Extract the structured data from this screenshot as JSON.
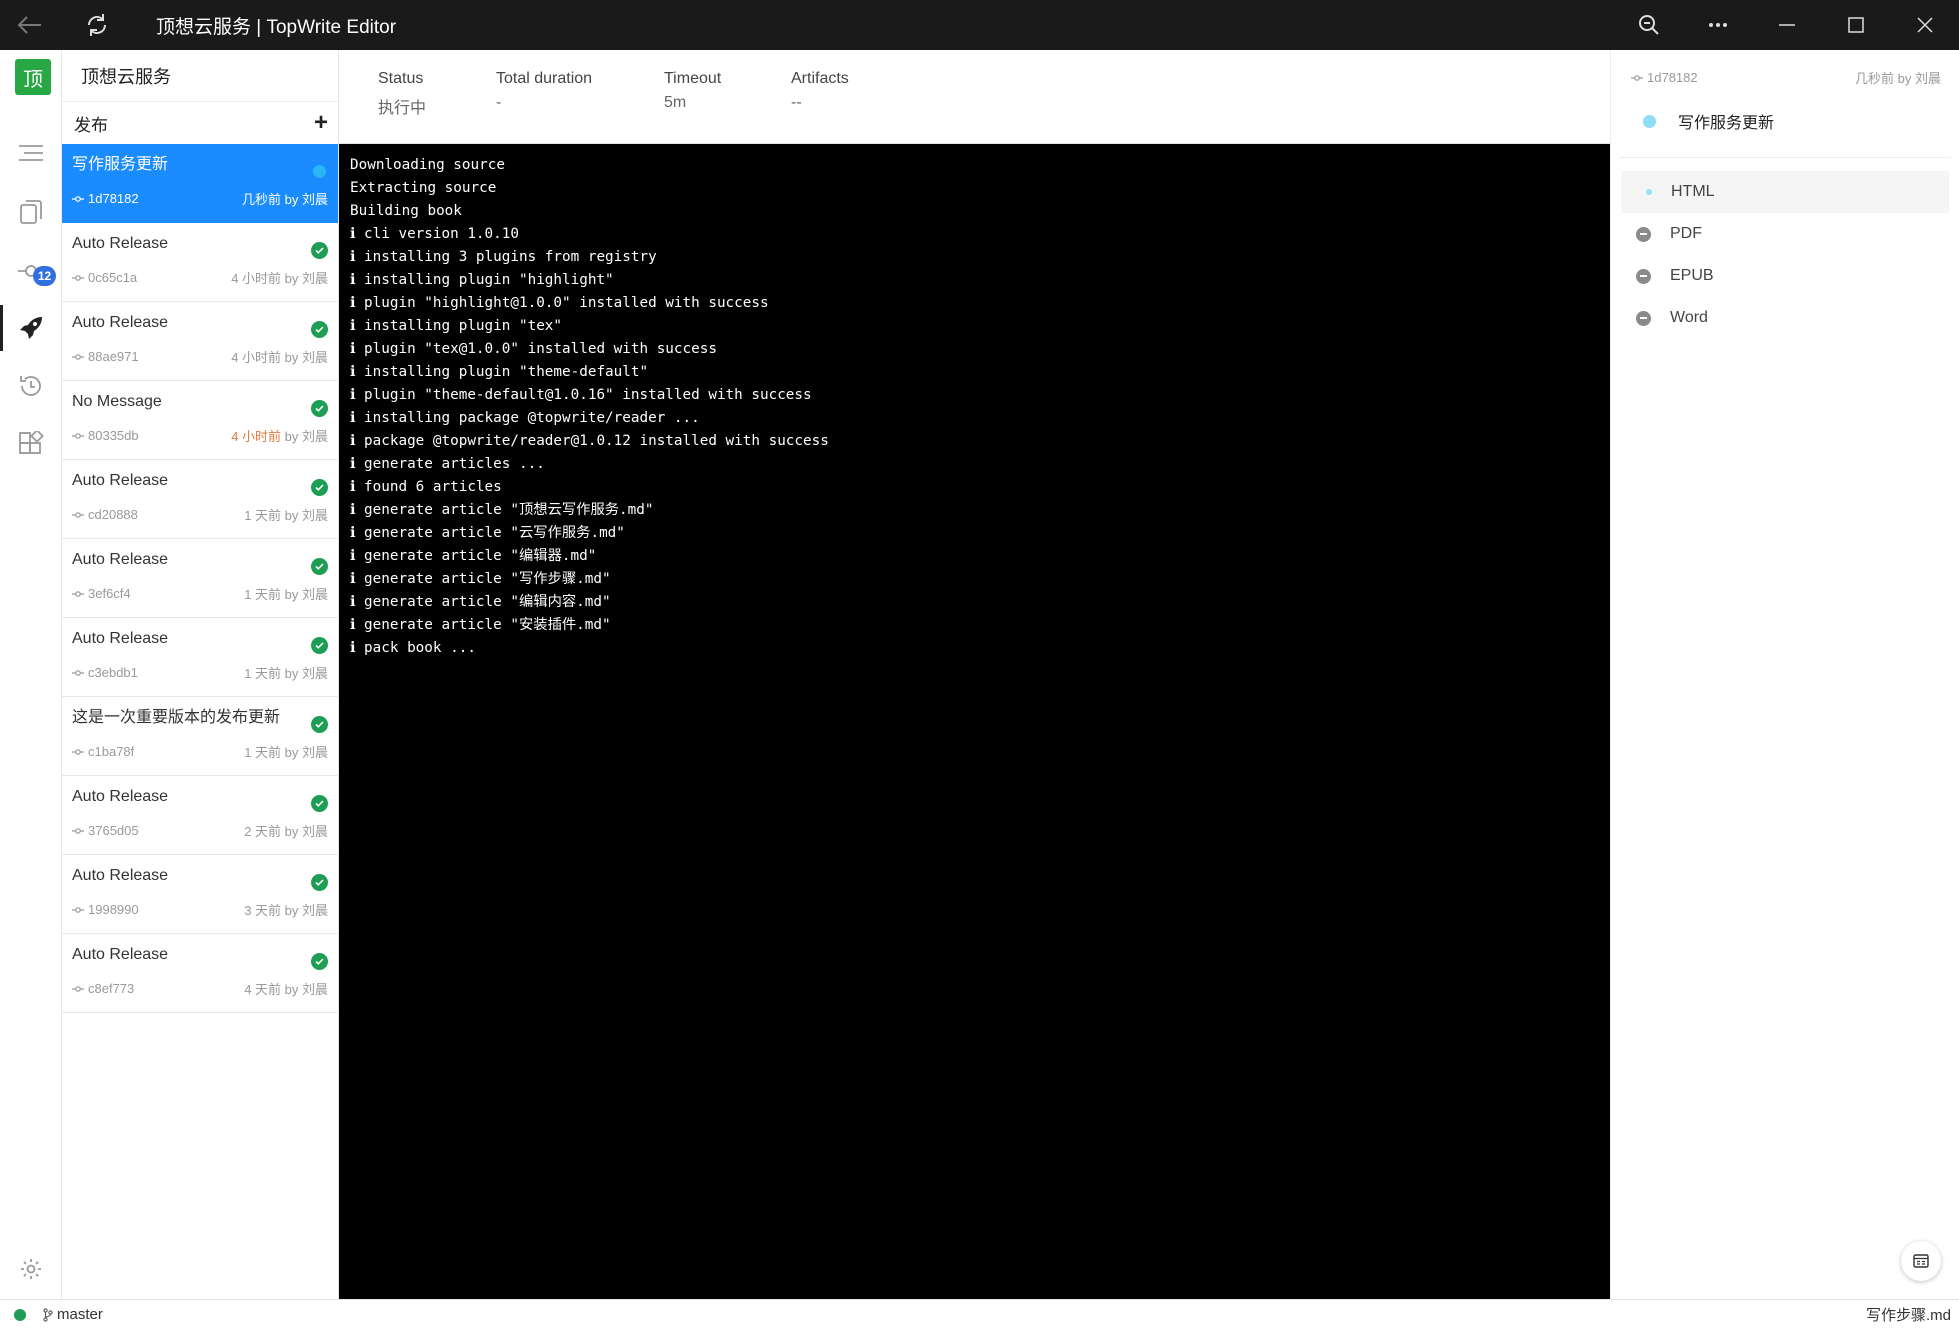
{
  "window": {
    "title": "顶想云服务 | TopWrite Editor"
  },
  "sidebar": {
    "logo_text": "顶",
    "badge_count": "12"
  },
  "project": {
    "name": "顶想云服务"
  },
  "releases": {
    "header": "发布",
    "add_label": "+",
    "items": [
      {
        "title": "写作服务更新",
        "commit": "1d78182",
        "time": "几秒前",
        "by": "by 刘晨",
        "status": "running",
        "selected": true
      },
      {
        "title": "Auto Release",
        "commit": "0c65c1a",
        "time": "4 小时前",
        "by": "by 刘晨",
        "status": "success"
      },
      {
        "title": "Auto Release",
        "commit": "88ae971",
        "time": "4 小时前",
        "by": "by 刘晨",
        "status": "success"
      },
      {
        "title": "No Message",
        "commit": "80335db",
        "time": "4 小时前",
        "by": "by 刘晨",
        "status": "success",
        "time_highlight": true
      },
      {
        "title": "Auto Release",
        "commit": "cd20888",
        "time": "1 天前",
        "by": "by 刘晨",
        "status": "success"
      },
      {
        "title": "Auto Release",
        "commit": "3ef6cf4",
        "time": "1 天前",
        "by": "by 刘晨",
        "status": "success"
      },
      {
        "title": "Auto Release",
        "commit": "c3ebdb1",
        "time": "1 天前",
        "by": "by 刘晨",
        "status": "success"
      },
      {
        "title": "这是一次重要版本的发布更新",
        "commit": "c1ba78f",
        "time": "1 天前",
        "by": "by 刘晨",
        "status": "success"
      },
      {
        "title": "Auto Release",
        "commit": "3765d05",
        "time": "2 天前",
        "by": "by 刘晨",
        "status": "success"
      },
      {
        "title": "Auto Release",
        "commit": "1998990",
        "time": "3 天前",
        "by": "by 刘晨",
        "status": "success"
      },
      {
        "title": "Auto Release",
        "commit": "c8ef773",
        "time": "4 天前",
        "by": "by 刘晨",
        "status": "success"
      }
    ]
  },
  "stats": {
    "status_label": "Status",
    "status_value": "执行中",
    "duration_label": "Total duration",
    "duration_value": "-",
    "timeout_label": "Timeout",
    "timeout_value": "5m",
    "artifacts_label": "Artifacts",
    "artifacts_value": "--"
  },
  "log": [
    "Downloading source",
    "Extracting source",
    "Building book",
    "ℹ cli version 1.0.10",
    "ℹ installing 3 plugins from registry",
    "ℹ installing plugin \"highlight\"",
    "ℹ plugin \"highlight@1.0.0\" installed with success",
    "ℹ installing plugin \"tex\"",
    "ℹ plugin \"tex@1.0.0\" installed with success",
    "ℹ installing plugin \"theme-default\"",
    "ℹ plugin \"theme-default@1.0.16\" installed with success",
    "ℹ installing package @topwrite/reader ...",
    "ℹ package @topwrite/reader@1.0.12 installed with success",
    "ℹ generate articles ...",
    "ℹ found 6 articles",
    "ℹ generate article \"顶想云写作服务.md\"",
    "ℹ generate article \"云写作服务.md\"",
    "ℹ generate article \"编辑器.md\"",
    "ℹ generate article \"写作步骤.md\"",
    "ℹ generate article \"编辑内容.md\"",
    "ℹ generate article \"安装插件.md\"",
    "ℹ pack book ..."
  ],
  "detail": {
    "commit": "1d78182",
    "time": "几秒前 by 刘晨",
    "release_title": "写作服务更新",
    "artifacts": [
      {
        "label": "HTML",
        "state": "pending"
      },
      {
        "label": "PDF",
        "state": "skipped"
      },
      {
        "label": "EPUB",
        "state": "skipped"
      },
      {
        "label": "Word",
        "state": "skipped"
      }
    ]
  },
  "statusbar": {
    "branch": "master",
    "file": "写作步骤.md"
  },
  "colors": {
    "accent": "#1a8cff",
    "success": "#1e9e55",
    "running": "#29b6f6",
    "logo": "#28a745",
    "badge": "#2f6fe0",
    "titlebar": "#1a1a1a"
  }
}
